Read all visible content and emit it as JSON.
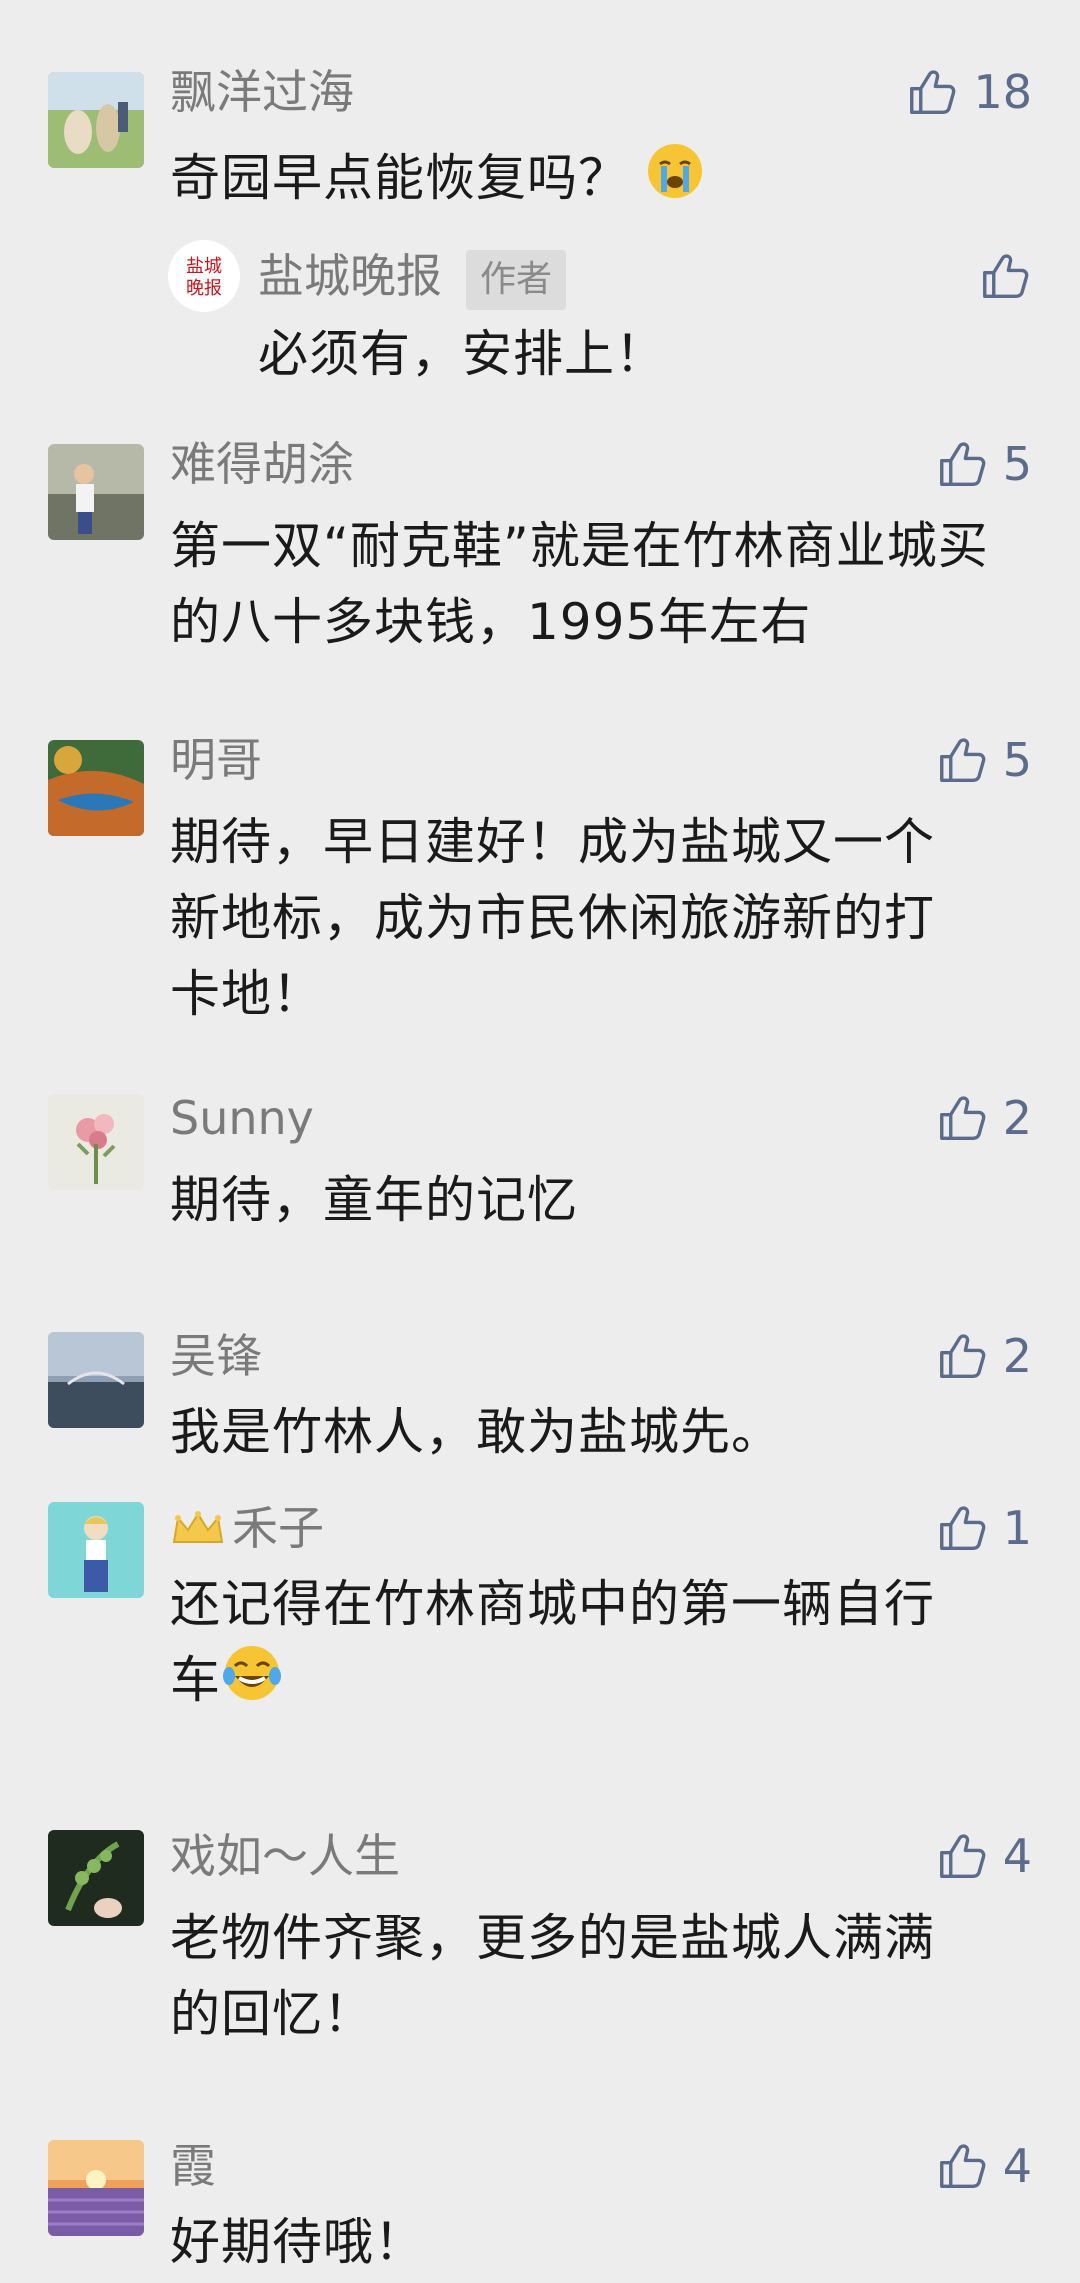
{
  "comments": [
    {
      "name": "飘洋过海",
      "text": "奇园早点能恢复吗？",
      "likes": "18"
    },
    {
      "name": "难得胡涂",
      "line1": "第一双“耐克鞋”就是在竹林商业城买",
      "line2": "的八十多块钱，1995年左右",
      "likes": "5"
    },
    {
      "name": "明哥",
      "line1": "期待，早日建好！成为盐城又一个",
      "line2": "新地标，成为市民休闲旅游新的打",
      "line3": "卡地！",
      "likes": "5"
    },
    {
      "name": "Sunny",
      "text": "期待，童年的记忆",
      "likes": "2"
    },
    {
      "name": "吴锋",
      "text": "我是竹林人，敢为盐城先。",
      "likes": "2"
    },
    {
      "name": "禾子",
      "line1": "还记得在竹林商城中的第一辆自行",
      "line2": "车",
      "likes": "1"
    },
    {
      "name": "戏如～人生",
      "line1": "老物件齐聚，更多的是盐城人满满",
      "line2": "的回忆！",
      "likes": "4"
    },
    {
      "name": "霞",
      "text": "好期待哦！",
      "likes": "4"
    }
  ],
  "reply": {
    "name": "盐城晚报",
    "tag": "作者",
    "text": "必须有，安排上！",
    "logo_text": "盐城晚报"
  },
  "colors": {
    "background": "#ededed",
    "name": "#7a7a7a",
    "text": "#1a1a1a",
    "like": "#5b6b8c"
  },
  "icons": {
    "like": "thumbs-up-icon",
    "crown": "crown-icon",
    "cry_emoji": "crying-face-emoji",
    "laugh_emoji": "tears-of-joy-emoji"
  }
}
